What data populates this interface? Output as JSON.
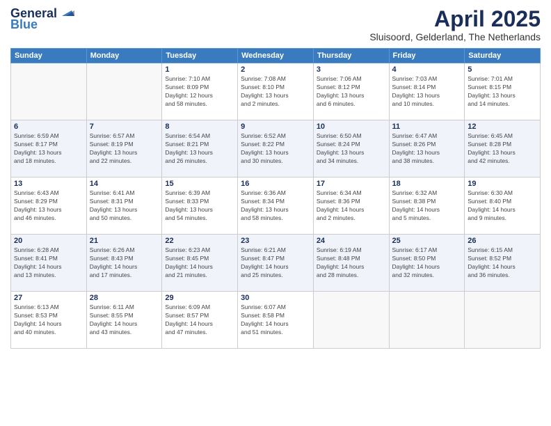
{
  "header": {
    "logo": {
      "general": "General",
      "blue": "Blue"
    },
    "title": "April 2025",
    "location": "Sluisoord, Gelderland, The Netherlands"
  },
  "days_of_week": [
    "Sunday",
    "Monday",
    "Tuesday",
    "Wednesday",
    "Thursday",
    "Friday",
    "Saturday"
  ],
  "weeks": [
    [
      {
        "day": "",
        "info": ""
      },
      {
        "day": "",
        "info": ""
      },
      {
        "day": "1",
        "info": "Sunrise: 7:10 AM\nSunset: 8:09 PM\nDaylight: 12 hours\nand 58 minutes."
      },
      {
        "day": "2",
        "info": "Sunrise: 7:08 AM\nSunset: 8:10 PM\nDaylight: 13 hours\nand 2 minutes."
      },
      {
        "day": "3",
        "info": "Sunrise: 7:06 AM\nSunset: 8:12 PM\nDaylight: 13 hours\nand 6 minutes."
      },
      {
        "day": "4",
        "info": "Sunrise: 7:03 AM\nSunset: 8:14 PM\nDaylight: 13 hours\nand 10 minutes."
      },
      {
        "day": "5",
        "info": "Sunrise: 7:01 AM\nSunset: 8:15 PM\nDaylight: 13 hours\nand 14 minutes."
      }
    ],
    [
      {
        "day": "6",
        "info": "Sunrise: 6:59 AM\nSunset: 8:17 PM\nDaylight: 13 hours\nand 18 minutes."
      },
      {
        "day": "7",
        "info": "Sunrise: 6:57 AM\nSunset: 8:19 PM\nDaylight: 13 hours\nand 22 minutes."
      },
      {
        "day": "8",
        "info": "Sunrise: 6:54 AM\nSunset: 8:21 PM\nDaylight: 13 hours\nand 26 minutes."
      },
      {
        "day": "9",
        "info": "Sunrise: 6:52 AM\nSunset: 8:22 PM\nDaylight: 13 hours\nand 30 minutes."
      },
      {
        "day": "10",
        "info": "Sunrise: 6:50 AM\nSunset: 8:24 PM\nDaylight: 13 hours\nand 34 minutes."
      },
      {
        "day": "11",
        "info": "Sunrise: 6:47 AM\nSunset: 8:26 PM\nDaylight: 13 hours\nand 38 minutes."
      },
      {
        "day": "12",
        "info": "Sunrise: 6:45 AM\nSunset: 8:28 PM\nDaylight: 13 hours\nand 42 minutes."
      }
    ],
    [
      {
        "day": "13",
        "info": "Sunrise: 6:43 AM\nSunset: 8:29 PM\nDaylight: 13 hours\nand 46 minutes."
      },
      {
        "day": "14",
        "info": "Sunrise: 6:41 AM\nSunset: 8:31 PM\nDaylight: 13 hours\nand 50 minutes."
      },
      {
        "day": "15",
        "info": "Sunrise: 6:39 AM\nSunset: 8:33 PM\nDaylight: 13 hours\nand 54 minutes."
      },
      {
        "day": "16",
        "info": "Sunrise: 6:36 AM\nSunset: 8:34 PM\nDaylight: 13 hours\nand 58 minutes."
      },
      {
        "day": "17",
        "info": "Sunrise: 6:34 AM\nSunset: 8:36 PM\nDaylight: 14 hours\nand 2 minutes."
      },
      {
        "day": "18",
        "info": "Sunrise: 6:32 AM\nSunset: 8:38 PM\nDaylight: 14 hours\nand 5 minutes."
      },
      {
        "day": "19",
        "info": "Sunrise: 6:30 AM\nSunset: 8:40 PM\nDaylight: 14 hours\nand 9 minutes."
      }
    ],
    [
      {
        "day": "20",
        "info": "Sunrise: 6:28 AM\nSunset: 8:41 PM\nDaylight: 14 hours\nand 13 minutes."
      },
      {
        "day": "21",
        "info": "Sunrise: 6:26 AM\nSunset: 8:43 PM\nDaylight: 14 hours\nand 17 minutes."
      },
      {
        "day": "22",
        "info": "Sunrise: 6:23 AM\nSunset: 8:45 PM\nDaylight: 14 hours\nand 21 minutes."
      },
      {
        "day": "23",
        "info": "Sunrise: 6:21 AM\nSunset: 8:47 PM\nDaylight: 14 hours\nand 25 minutes."
      },
      {
        "day": "24",
        "info": "Sunrise: 6:19 AM\nSunset: 8:48 PM\nDaylight: 14 hours\nand 28 minutes."
      },
      {
        "day": "25",
        "info": "Sunrise: 6:17 AM\nSunset: 8:50 PM\nDaylight: 14 hours\nand 32 minutes."
      },
      {
        "day": "26",
        "info": "Sunrise: 6:15 AM\nSunset: 8:52 PM\nDaylight: 14 hours\nand 36 minutes."
      }
    ],
    [
      {
        "day": "27",
        "info": "Sunrise: 6:13 AM\nSunset: 8:53 PM\nDaylight: 14 hours\nand 40 minutes."
      },
      {
        "day": "28",
        "info": "Sunrise: 6:11 AM\nSunset: 8:55 PM\nDaylight: 14 hours\nand 43 minutes."
      },
      {
        "day": "29",
        "info": "Sunrise: 6:09 AM\nSunset: 8:57 PM\nDaylight: 14 hours\nand 47 minutes."
      },
      {
        "day": "30",
        "info": "Sunrise: 6:07 AM\nSunset: 8:58 PM\nDaylight: 14 hours\nand 51 minutes."
      },
      {
        "day": "",
        "info": ""
      },
      {
        "day": "",
        "info": ""
      },
      {
        "day": "",
        "info": ""
      }
    ]
  ]
}
